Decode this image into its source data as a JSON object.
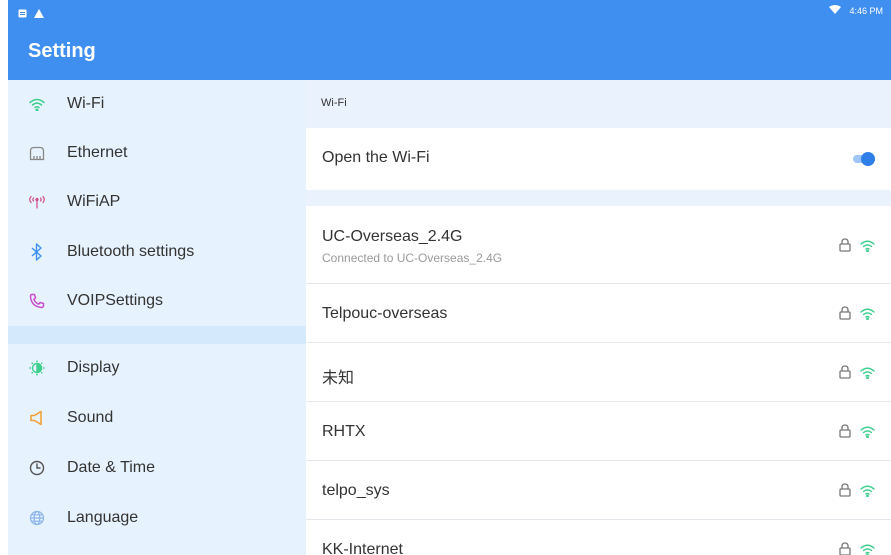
{
  "status_bar": {
    "time": "4:46 PM",
    "icons": [
      "notification-icon",
      "warning-icon",
      "wifi-signal-icon"
    ]
  },
  "app_bar": {
    "title": "Setting"
  },
  "sidebar": {
    "items": [
      {
        "label": "Wi-Fi",
        "icon": "wifi-icon"
      },
      {
        "label": "Ethernet",
        "icon": "ethernet-icon"
      },
      {
        "label": "WiFiAP",
        "icon": "hotspot-icon"
      },
      {
        "label": "Bluetooth settings",
        "icon": "bluetooth-icon"
      },
      {
        "label": "VOIPSettings",
        "icon": "phone-icon"
      },
      {
        "label": "Display",
        "icon": "display-icon"
      },
      {
        "label": "Sound",
        "icon": "sound-icon"
      },
      {
        "label": "Date & Time",
        "icon": "clock-icon"
      },
      {
        "label": "Language",
        "icon": "globe-icon"
      }
    ]
  },
  "main": {
    "header": "Wi-Fi",
    "toggle": {
      "label": "Open the Wi-Fi",
      "on": true
    },
    "networks": [
      {
        "name": "UC-Overseas_2.4G",
        "status": "Connected to UC-Overseas_2.4G",
        "secured": true
      },
      {
        "name": "Telpouc-overseas",
        "secured": true
      },
      {
        "name": "未知",
        "secured": true
      },
      {
        "name": "RHTX",
        "secured": true
      },
      {
        "name": "telpo_sys",
        "secured": true
      },
      {
        "name": "KK-Internet",
        "secured": true
      }
    ]
  },
  "colors": {
    "primary": "#3f8ff0",
    "sidebar_bg": "#e6f2fd",
    "accent_wifi": "#3ecf8e",
    "switch_on": "#2f7fe8"
  }
}
